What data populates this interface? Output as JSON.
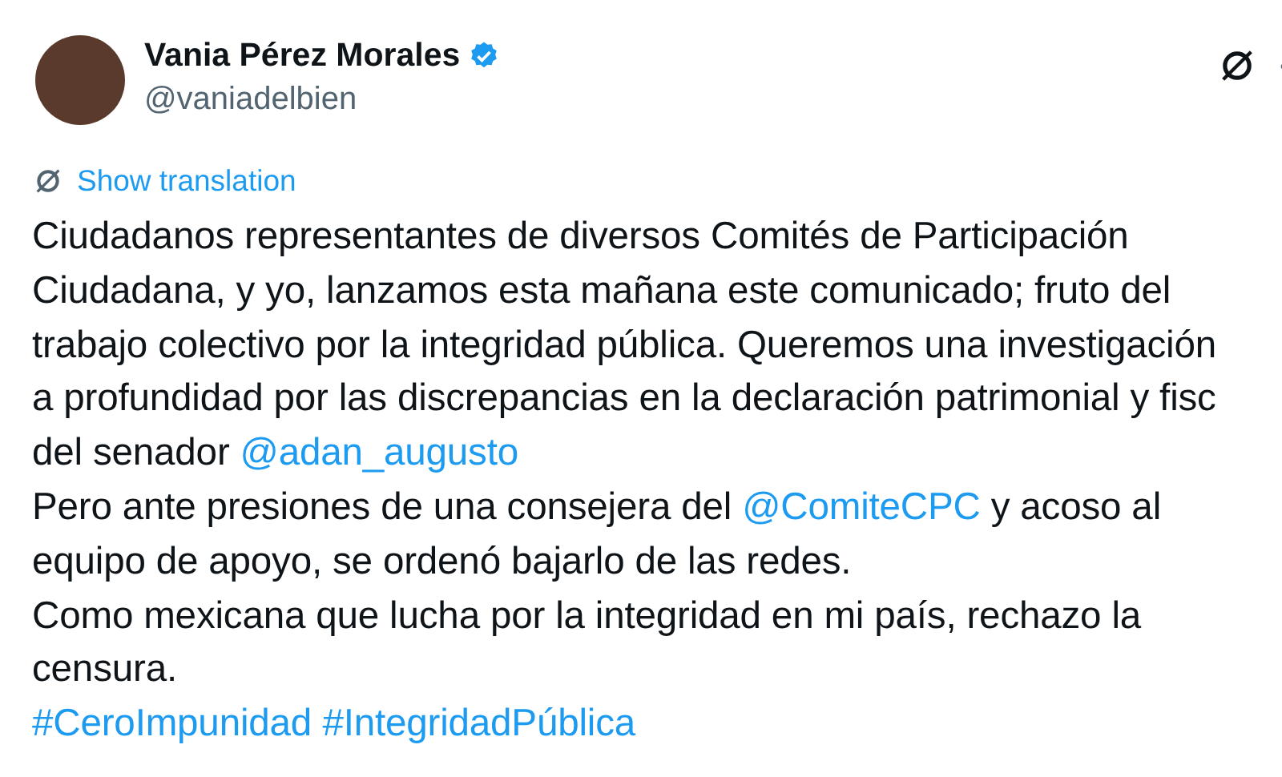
{
  "author": {
    "name": "Vania Pérez Morales",
    "verified": true,
    "handle": "@vaniadelbien"
  },
  "translation_link": "Show translation",
  "tweet_lines": [
    [
      {
        "kind": "text",
        "text": "Ciudadanos representantes de diversos Comités de Participación"
      }
    ],
    [
      {
        "kind": "text",
        "text": "Ciudadana, y yo, lanzamos esta mañana este comunicado; fruto del"
      }
    ],
    [
      {
        "kind": "text",
        "text": "trabajo colectivo por la integridad pública. Queremos una investigación"
      }
    ],
    [
      {
        "kind": "text",
        "text": "a profundidad por las discrepancias en la declaración patrimonial y fisc"
      }
    ],
    [
      {
        "kind": "text",
        "text": "del senador "
      },
      {
        "kind": "link",
        "text": "@adan_augusto"
      }
    ],
    [
      {
        "kind": "text",
        "text": "Pero ante presiones de una consejera del "
      },
      {
        "kind": "link",
        "text": "@ComiteCPC"
      },
      {
        "kind": "text",
        "text": " y acoso al"
      }
    ],
    [
      {
        "kind": "text",
        "text": "equipo de apoyo, se ordenó bajarlo de las redes."
      }
    ],
    [
      {
        "kind": "text",
        "text": "Como mexicana que lucha por la integridad en mi país, rechazo la"
      }
    ],
    [
      {
        "kind": "text",
        "text": "censura."
      }
    ],
    [
      {
        "kind": "link",
        "text": "#CeroImpunidad"
      },
      {
        "kind": "link",
        "text": "#IntegridadPública"
      }
    ]
  ]
}
